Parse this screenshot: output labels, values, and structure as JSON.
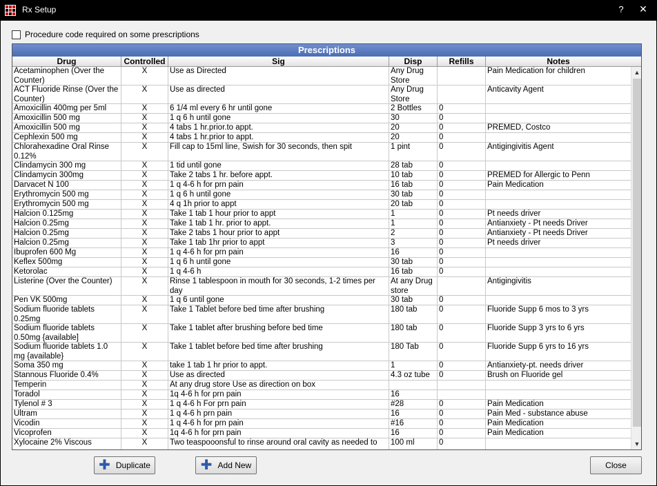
{
  "window": {
    "title": "Rx Setup",
    "help": "?",
    "close": "✕"
  },
  "procedure_checkbox": {
    "label": "Procedure code required on some prescriptions",
    "checked": false
  },
  "grid": {
    "title": "Prescriptions",
    "columns": [
      "Drug",
      "Controlled",
      "Sig",
      "Disp",
      "Refills",
      "Notes"
    ],
    "rows": [
      [
        "Acetaminophen (Over the Counter)",
        "X",
        "Use as Directed",
        "Any Drug Store",
        "",
        "Pain Medication for children"
      ],
      [
        "ACT Fluoride Rinse (Over the Counter)",
        "X",
        "Use as directed",
        "Any Drug Store",
        "",
        "Anticavity Agent"
      ],
      [
        "Amoxicillin 400mg per 5ml",
        "X",
        "6 1/4 ml every 6 hr until gone",
        "2 Bottles",
        "0",
        ""
      ],
      [
        "Amoxicillin 500 mg",
        "X",
        "1 q 6 h until gone",
        "30",
        "0",
        ""
      ],
      [
        "Amoxicillin 500 mg",
        "X",
        "4 tabs 1 hr.prior.to appt.",
        "20",
        "0",
        "PREMED, Costco"
      ],
      [
        "Cephlexin 500 mg",
        "X",
        "4 tabs 1 hr.prior to appt.",
        "20",
        "0",
        ""
      ],
      [
        "Chlorahexadine Oral Rinse 0.12%",
        "X",
        "Fill cap to 15ml line, Swish for 30 seconds, then spit",
        "1 pint",
        "0",
        "Antigingivitis Agent"
      ],
      [
        "Clindamycin 300 mg",
        "X",
        "1 tid until gone",
        "28 tab",
        "0",
        ""
      ],
      [
        "Clindamycin 300mg",
        "X",
        "Take 2 tabs 1 hr. before appt.",
        "10 tab",
        "0",
        "PREMED for Allergic to Penn"
      ],
      [
        "Darvacet N 100",
        "X",
        "1 q 4-6 h for prn pain",
        "16 tab",
        "0",
        "Pain Medication"
      ],
      [
        "Erythromycin 500 mg",
        "X",
        "1 q 6 h until  gone",
        "30 tab",
        "0",
        ""
      ],
      [
        "Erythromycin 500 mg",
        "X",
        "4 q 1h prior to appt",
        "20 tab",
        "0",
        ""
      ],
      [
        "Halcion 0.125mg",
        "X",
        "Take 1 tab 1 hour prior to appt",
        "1",
        "0",
        "Pt needs driver"
      ],
      [
        "Halcion 0.25mg",
        "X",
        "Take 1 tab 1 hr. prior to appt.",
        "1",
        "0",
        "Antianxiety - Pt needs Driver"
      ],
      [
        "Halcion 0.25mg",
        "X",
        "Take 2 tabs 1 hour prior to appt",
        "2",
        "0",
        "Antianxiety - Pt needs Driver"
      ],
      [
        "Halcion 0.25mg",
        "X",
        "Take 1 tab 1hr prior to appt",
        "3",
        "0",
        "Pt needs driver"
      ],
      [
        "Ibuprofen 600 Mg",
        "X",
        "1 q 4-6 h for prn pain",
        "16",
        "0",
        ""
      ],
      [
        "Keflex 500mg",
        "X",
        "1 q 6 h until gone",
        "30 tab",
        "0",
        ""
      ],
      [
        "Ketorolac",
        "X",
        "1 q 4-6 h",
        "16 tab",
        "0",
        ""
      ],
      [
        "Listerine (Over the Counter)",
        "X",
        "Rinse 1 tablespoon in mouth for 30 seconds, 1-2 times per day",
        "At any Drug store",
        "",
        "Antigingivitis"
      ],
      [
        "Pen VK 500mg",
        "X",
        "1 q 6  until  gone",
        "30 tab",
        "0",
        ""
      ],
      [
        "Sodium fluoride tablets 0.25mg",
        "X",
        "Take 1 Tablet before bed time after brushing",
        "180 tab",
        "0",
        "Fluoride Supp 6 mos to 3 yrs"
      ],
      [
        "Sodium fluoride tablets 0.50mg {available]",
        "X",
        "Take 1 tablet after brushing before bed time",
        "180 tab",
        "0",
        "Fluoride Supp 3 yrs to 6 yrs"
      ],
      [
        "Sodium fluoride tablets 1.0 mg {available}",
        "X",
        "Take 1 tablet before bed time after brushing",
        "180 Tab",
        "0",
        "Fluoride Supp 6 yrs to 16 yrs"
      ],
      [
        "Soma 350 mg",
        "X",
        "take 1 tab 1 hr prior to appt.",
        "1",
        "0",
        "Antianxiety-pt. needs driver"
      ],
      [
        "Stannous Fluoride 0.4%",
        "X",
        "Use as directed",
        "4.3 oz tube",
        "0",
        "Brush on Fluoride gel"
      ],
      [
        "Temperin",
        "X",
        "At any drug store Use as direction on box",
        "",
        "",
        ""
      ],
      [
        "Toradol",
        "X",
        "1q 4-6 h for prn pain",
        "16",
        "",
        ""
      ],
      [
        "Tylenol # 3",
        "X",
        "1 q 4-6 h For prn pain",
        "#28",
        "0",
        "Pain Medication"
      ],
      [
        "Ultram",
        "X",
        "1 q 4-6 h prn pain",
        "16",
        "0",
        "Pain Med - substance abuse"
      ],
      [
        "Vicodin",
        "X",
        "1 q 4-6 h for prn pain",
        "#16",
        "0",
        "Pain Medication"
      ],
      [
        "Vicoprofen",
        "X",
        "1q 4-6 h for prn pain",
        "16",
        "0",
        "Pain Medication"
      ],
      [
        "Xylocaine 2% Viscous",
        "X",
        "Two teaspooonsful to rinse around oral cavity as needed to",
        "100 ml",
        "0",
        ""
      ]
    ],
    "row_lines": [
      2,
      2,
      1,
      1,
      1,
      1,
      2,
      1,
      1,
      1,
      1,
      1,
      1,
      1,
      1,
      1,
      1,
      1,
      1,
      2,
      1,
      2,
      2,
      2,
      1,
      1,
      1,
      1,
      1,
      1,
      1,
      1,
      2
    ]
  },
  "buttons": {
    "duplicate": "Duplicate",
    "add_new": "Add New",
    "close": "Close"
  }
}
